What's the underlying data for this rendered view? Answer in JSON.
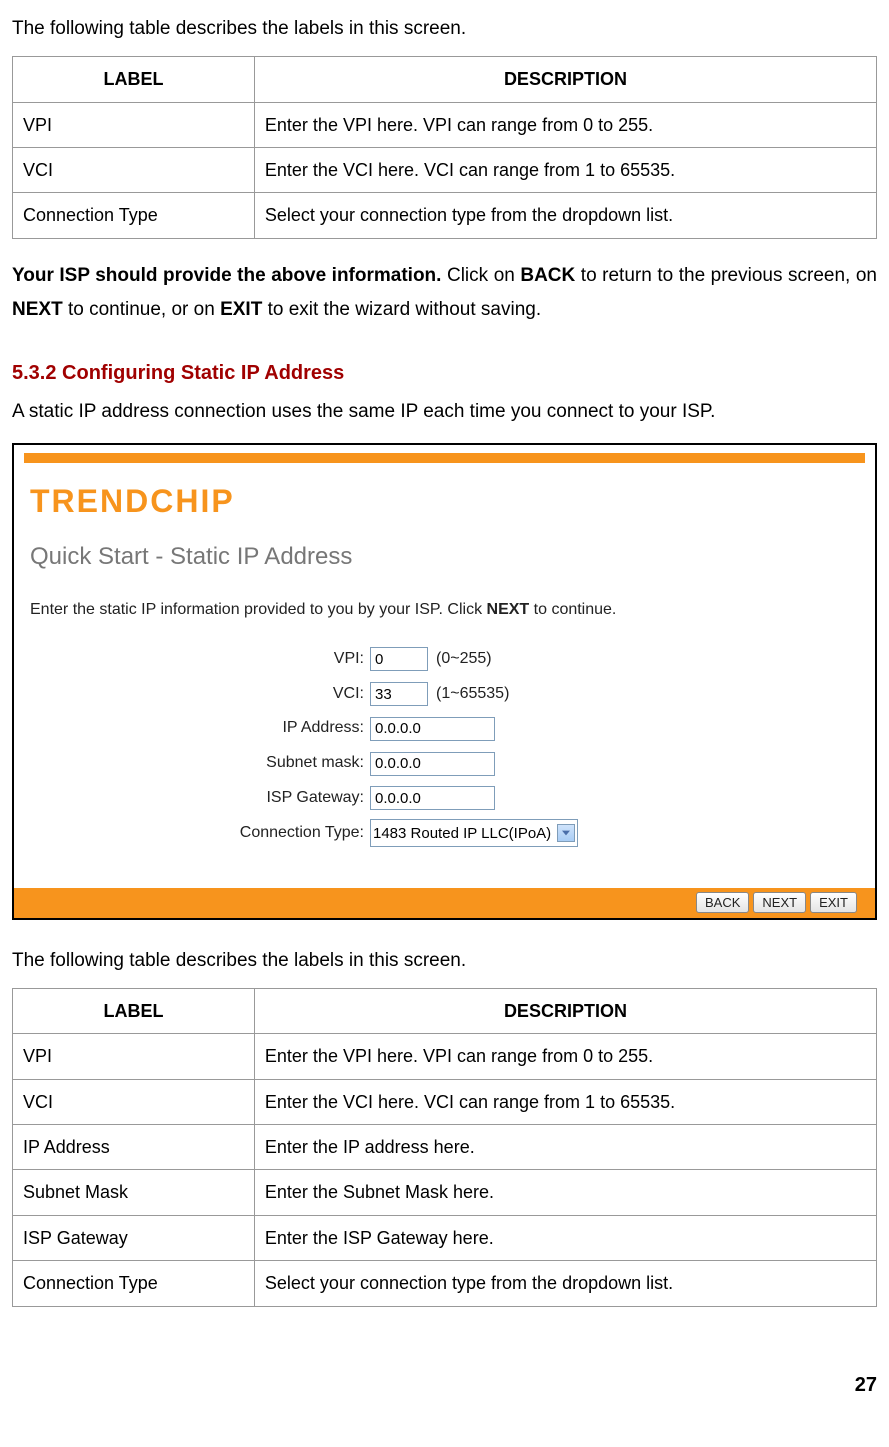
{
  "intro1": "The following table describes the labels in this screen.",
  "table1": {
    "head": {
      "label": "LABEL",
      "desc": "DESCRIPTION"
    },
    "rows": [
      {
        "label": "VPI",
        "desc": "Enter the VPI here. VPI can range from 0 to 255."
      },
      {
        "label": "VCI",
        "desc": "Enter the VCI here. VCI can range from 1 to 65535."
      },
      {
        "label": "Connection Type",
        "desc": "Select your connection type from the dropdown list."
      }
    ]
  },
  "nav_para": {
    "p1a": "Your ISP should provide the above information.",
    "p1b": " Click on ",
    "back": "BACK",
    "p1c": " to return to the previous screen, on ",
    "next": "NEXT",
    "p1d": " to continue, or on ",
    "exit": "EXIT",
    "p1e": " to exit the wizard without saving."
  },
  "section": {
    "num_title": "5.3.2 Configuring Static IP Address",
    "desc": "A static IP address connection uses the same IP each time you connect to your ISP."
  },
  "screenshot": {
    "brand": "TRENDCHIP",
    "title": "Quick Start - Static IP Address",
    "desc_a": "Enter the static IP information provided to you by your ISP. Click ",
    "desc_bold": "NEXT",
    "desc_b": " to continue.",
    "fields": {
      "vpi": {
        "label": "VPI:",
        "value": "0",
        "hint": "(0~255)"
      },
      "vci": {
        "label": "VCI:",
        "value": "33",
        "hint": "(1~65535)"
      },
      "ip": {
        "label": "IP Address:",
        "value": "0.0.0.0"
      },
      "subnet": {
        "label": "Subnet mask:",
        "value": "0.0.0.0"
      },
      "gateway": {
        "label": "ISP Gateway:",
        "value": "0.0.0.0"
      },
      "conn": {
        "label": "Connection Type:",
        "value": "1483 Routed IP LLC(IPoA)"
      }
    },
    "buttons": {
      "back": "BACK",
      "next": "NEXT",
      "exit": "EXIT"
    }
  },
  "intro2": "The following table describes the labels in this screen.",
  "table2": {
    "head": {
      "label": "LABEL",
      "desc": "DESCRIPTION"
    },
    "rows": [
      {
        "label": "VPI",
        "desc": "Enter the VPI here. VPI can range from 0 to 255."
      },
      {
        "label": "VCI",
        "desc": "Enter the VCI here. VCI can range from 1 to 65535."
      },
      {
        "label": "IP Address",
        "desc": "Enter the IP address here."
      },
      {
        "label": "Subnet Mask",
        "desc": "Enter the Subnet Mask here."
      },
      {
        "label": "ISP Gateway",
        "desc": "Enter the ISP Gateway here."
      },
      {
        "label": "Connection Type",
        "desc": "Select your connection type from the dropdown list."
      }
    ]
  },
  "page_number": "27"
}
